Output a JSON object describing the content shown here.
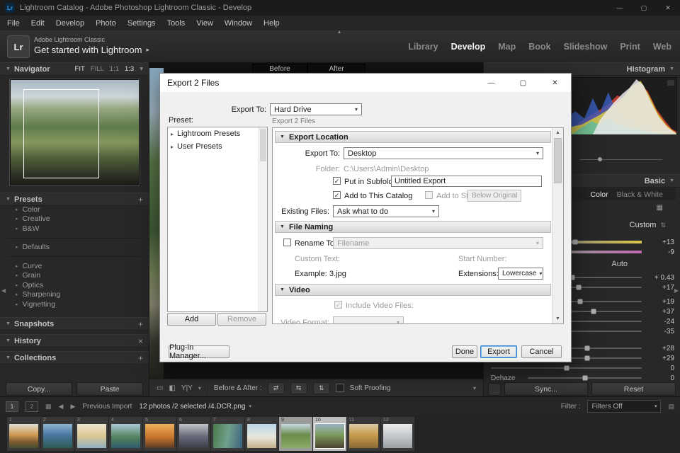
{
  "icons": {
    "tri_down": "▼",
    "tri_right": "▸",
    "dropdown": "▾",
    "scroll_up": "▲",
    "scroll_down": "▼",
    "nav_left": "◀",
    "nav_right": "▶",
    "plus": "+",
    "clear": "×",
    "minimize": "—",
    "maximize": "▢",
    "close": "✕",
    "check": "✓",
    "grid": "▦",
    "collapse_up": "▴",
    "swap_lr": "⇄",
    "swap_ud": "⇅",
    "copy_swap": "⇆",
    "loupe": "▭",
    "split": "◧",
    "yy": "Y|Y",
    "profile_toggle": "⇅",
    "lock": "▤",
    "arrow": "▸"
  },
  "titlebar": {
    "logo": "Lr",
    "app_title": "Lightroom Catalog - Adobe Photoshop Lightroom Classic - Develop"
  },
  "menubar": {
    "items": [
      "File",
      "Edit",
      "Develop",
      "Photo",
      "Settings",
      "Tools",
      "View",
      "Window",
      "Help"
    ]
  },
  "header": {
    "brand": "Lr",
    "identity_line1": "Adobe Lightroom Classic",
    "identity_line2": "Get started with Lightroom",
    "modules": [
      "Library",
      "Develop",
      "Map",
      "Book",
      "Slideshow",
      "Print",
      "Web"
    ]
  },
  "left_panel": {
    "navigator": {
      "title": "Navigator",
      "zoom_fit": "FIT",
      "zoom_fill": "FILL",
      "zoom_11": "1:1",
      "zoom_13": "1:3",
      "preview_style": "background:linear-gradient(180deg,#a8b8c4 0%,#cdd6d9 16%,#94a67e 28%,#5f7b4b 45%,#85975c 60%,#4e5c38 76%,#2c3024 92%,#1d2019 100%)"
    },
    "presets": {
      "title": "Presets",
      "items": [
        "Color",
        "Creative",
        "B&W",
        "Defaults",
        "Curve",
        "Grain",
        "Optics",
        "Sharpening",
        "Vignetting"
      ]
    },
    "snapshots_title": "Snapshots",
    "history_title": "History",
    "collections_title": "Collections",
    "copy_label": "Copy...",
    "paste_label": "Paste"
  },
  "center": {
    "before_tab": "Before",
    "after_tab": "After",
    "photo_style": "background:linear-gradient(180deg,#87a9c0 0%,#a9bfcc 14%,#5f7b4b 30%,#43603a 52%,#7c8a5e 66%,#92917a 76%,#3c3e33 88%,#20211c 100%)",
    "toolbar": {
      "before_after_label": "Before & After :",
      "soft_proofing_label": "Soft Proofing"
    }
  },
  "dialog": {
    "title": "Export 2 Files",
    "export_to_label": "Export To:",
    "export_to_value": "Hard Drive",
    "preset_label": "Preset:",
    "preset_items": [
      "Lightroom Presets",
      "User Presets"
    ],
    "add_label": "Add",
    "remove_label": "Remove",
    "files_label": "Export 2 Files",
    "export_location": {
      "title": "Export Location",
      "export_to_label": "Export To:",
      "export_to_value": "Desktop",
      "folder_label": "Folder:",
      "folder_value": "C:\\Users\\Admin\\Desktop",
      "subfolder_label": "Put in Subfolder:",
      "subfolder_value": "Untitled Export",
      "catalog_label": "Add to This Catalog",
      "stack_label": "Add to Stack:",
      "stack_value": "Below Original",
      "existing_label": "Existing Files:",
      "existing_value": "Ask what to do"
    },
    "file_naming": {
      "title": "File Naming",
      "rename_label": "Rename To:",
      "rename_value": "Filename",
      "custom_text_label": "Custom Text:",
      "start_number_label": "Start Number:",
      "example_label": "Example:",
      "example_value": "3.jpg",
      "extensions_label": "Extensions:",
      "extensions_value": "Lowercase"
    },
    "video": {
      "title": "Video",
      "include_label": "Include Video Files:",
      "format_label": "Video Format:"
    },
    "plugin_manager_label": "Plug-in Manager...",
    "done_label": "Done",
    "export_label": "Export",
    "cancel_label": "Cancel"
  },
  "right_panel": {
    "histogram": {
      "title": "Histogram",
      "colors": {
        "red": "#c13b2e",
        "yellow": "#d8cc3f",
        "blue": "#3b5fc1",
        "cyan": "#3fc1c1",
        "white": "#e9e9e9"
      }
    },
    "basic": {
      "title": "Basic",
      "color_label": "Color",
      "bw_label": "Black & White",
      "profile_value": "Custom",
      "auto_label": "Auto",
      "wb": [
        {
          "value": "+13",
          "thumb": "left:56%"
        },
        {
          "value": "-9",
          "thumb": "left:45%"
        }
      ],
      "tone": [
        {
          "value": "+ 0.43",
          "thumb": "left:54%"
        },
        {
          "value": "+17",
          "thumb": "left:58%"
        }
      ],
      "tone2": [
        {
          "value": "+19",
          "thumb": "left:59%"
        },
        {
          "value": "+37",
          "thumb": "left:68%"
        },
        {
          "value": "-24",
          "thumb": "left:38%"
        },
        {
          "value": "-35",
          "thumb": "left:33%"
        }
      ],
      "presence": [
        {
          "value": "+28",
          "thumb": "left:64%"
        },
        {
          "value": "+29",
          "thumb": "left:64%"
        },
        {
          "value": "0",
          "thumb": "left:50%"
        }
      ],
      "dehaze": {
        "label": "Dehaze",
        "value": "0",
        "thumb": "left:50%"
      }
    },
    "sync_label": "Sync...",
    "reset_label": "Reset"
  },
  "statusbar": {
    "window_1": "1",
    "window_2": "2",
    "previous_import": "Previous Import",
    "selection_info": "12 photos /2 selected /4.DCR.png",
    "filter_label": "Filter :",
    "filter_value": "Filters Off"
  },
  "filmstrip": {
    "items": [
      {
        "index": "1",
        "bg": "background:linear-gradient(180deg,#e0ded2 0%,#cf9a52 45%,#7a5a2e 75%,#43502e 100%)"
      },
      {
        "index": "2",
        "bg": "background:linear-gradient(180deg,#8fb6d0 0%,#4878a0 45%,#2c5c54 100%)"
      },
      {
        "index": "3",
        "bg": "background:linear-gradient(180deg,#ece5cd 0%,#dcc794 50%,#8fb0c0 100%)"
      },
      {
        "index": "4",
        "bg": "background:linear-gradient(180deg,#a9c8d8 0%,#54825e 55%,#2c5c6c 100%)"
      },
      {
        "index": "5",
        "bg": "background:linear-gradient(180deg,#eeb05a 0%,#c8742e 55%,#5c3c24 100%)"
      },
      {
        "index": "6",
        "bg": "background:linear-gradient(180deg,#c0c4c8 0%,#6a6c7c 50%,#3a3c48 100%)"
      },
      {
        "index": "7",
        "bg": "background:linear-gradient(100deg,#4a7a4a 0%,#6fa08c 50%,#3c6280 100%)"
      },
      {
        "index": "8",
        "bg": "background:linear-gradient(180deg,#bcd8e8 0%,#e8e6da 55%,#c4b088 100%)"
      },
      {
        "index": "9",
        "bg": "background:linear-gradient(180deg,#c8d8e4 0%,#6c8c4c 45%,#8cab6a 100%)"
      },
      {
        "index": "10",
        "bg": "background:linear-gradient(180deg,#9ab2c2 0%,#7c9c5c 45%,#4c4030 100%)"
      },
      {
        "index": "11",
        "bg": "background:linear-gradient(180deg,#dccba6 0%,#c89c4c 45%,#8a6a34 100%)"
      },
      {
        "index": "12",
        "bg": "background:linear-gradient(180deg,#ececec 0%,#c0c4c8 55%,#9aa0a4 100%)"
      }
    ]
  }
}
